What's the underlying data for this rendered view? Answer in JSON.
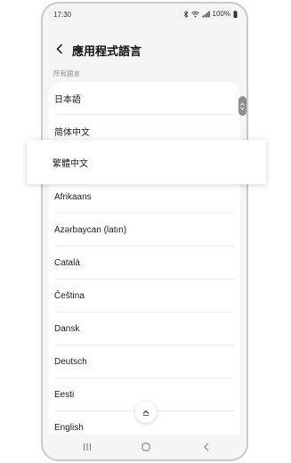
{
  "status": {
    "time": "17:30",
    "battery": "100%",
    "icons": [
      "bluetooth-icon",
      "wifi-icon",
      "signal-icon",
      "battery-icon"
    ]
  },
  "header": {
    "title": "應用程式語言",
    "back_icon": "back-arrow-icon"
  },
  "section": {
    "label": "所有語言"
  },
  "languages": [
    "日本語",
    "简体中文",
    "繁體中文",
    "Afrikaans",
    "Azərbaycan (latın)",
    "Català",
    "Čeština",
    "Dansk",
    "Deutsch",
    "Eesti",
    "English"
  ],
  "highlighted_index": 2,
  "navbar": {
    "icons": [
      "recents-icon",
      "home-icon",
      "back-icon"
    ]
  },
  "colors": {
    "screen_bg": "#f5f5f5",
    "card_bg": "#ffffff",
    "divider": "#ececec",
    "muted_text": "#8a8a8a",
    "scrollbar": "#8e8e8e"
  }
}
